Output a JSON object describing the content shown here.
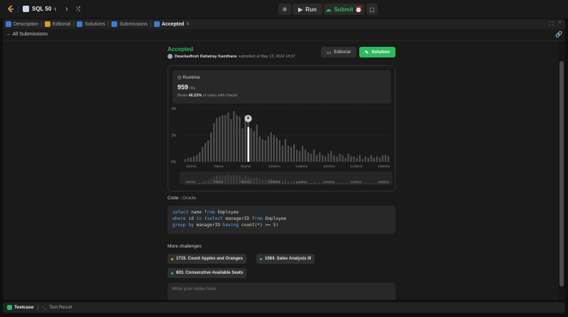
{
  "topbar": {
    "problem_list_title": "SQL 50",
    "run_label": "Run",
    "submit_label": "Submit"
  },
  "tabs": [
    {
      "label": "Description"
    },
    {
      "label": "Editorial"
    },
    {
      "label": "Solutions"
    },
    {
      "label": "Submissions"
    },
    {
      "label": "Accepted",
      "close": "×"
    }
  ],
  "subbar": {
    "back_label": "All Submissions"
  },
  "submission": {
    "status": "Accepted",
    "username": "Dwarkadhish Dattatray Kamthane",
    "submitted_text": "submitted at May 13, 2024 18:57",
    "editorial_label": "Editorial",
    "solution_label": "Solution"
  },
  "runtime": {
    "label": "Runtime",
    "value": "959",
    "unit": "ms",
    "beats_prefix": "Beats",
    "beats_value": "46.53%",
    "beats_suffix": "of users with Oracle"
  },
  "chart_data": {
    "type": "bar",
    "y_ticks": [
      "4%",
      "2%",
      "0%"
    ],
    "ylim": [
      0,
      4
    ],
    "x_tick_labels": [
      "634ms",
      "768ms",
      "901ms",
      "1035ms",
      "1168ms",
      "1302ms",
      "1435ms",
      "1569ms"
    ],
    "values": [
      0.2,
      0.3,
      0.3,
      0.4,
      0.5,
      0.7,
      1.1,
      1.4,
      1.6,
      2.2,
      2.9,
      3.3,
      3.4,
      3.5,
      3.5,
      3.7,
      3.2,
      3.8,
      3.5,
      3.4,
      2.5,
      3.5,
      3.0,
      2.5,
      2.3,
      2.8,
      1.9,
      1.7,
      1.6,
      1.9,
      2.2,
      2.0,
      1.8,
      1.6,
      1.2,
      1.7,
      1.2,
      1.1,
      1.3,
      0.9,
      0.8,
      1.2,
      0.9,
      0.7,
      0.6,
      0.9,
      0.5,
      0.7,
      0.5,
      0.4,
      0.6,
      0.8,
      0.5,
      0.4,
      0.6,
      0.5,
      0.3,
      0.6,
      0.4,
      0.4,
      0.3,
      0.5,
      0.2,
      0.4,
      0.3,
      0.5,
      0.3,
      0.4,
      0.3,
      0.5,
      0.5,
      0.4
    ],
    "highlight_index": 22,
    "highlight_value": 2.6,
    "grid": true,
    "colors": {
      "bar": "#505050",
      "highlight": "#ffffff",
      "grid": "#3a3a3a"
    }
  },
  "code": {
    "title": "Code",
    "lang": "Oracle",
    "lines": [
      [
        {
          "t": "select ",
          "k": "kw"
        },
        {
          "t": "name "
        },
        {
          "t": "from ",
          "k": "kw"
        },
        {
          "t": "Employee"
        }
      ],
      [
        {
          "t": "where ",
          "k": "kw"
        },
        {
          "t": "id "
        },
        {
          "t": "in ",
          "k": "kw"
        },
        {
          "t": "("
        },
        {
          "t": "select ",
          "k": "kw"
        },
        {
          "t": "managerID "
        },
        {
          "t": "from ",
          "k": "kw"
        },
        {
          "t": "Employee"
        }
      ],
      [
        {
          "t": "group by ",
          "k": "kw"
        },
        {
          "t": "managerID "
        },
        {
          "t": "having ",
          "k": "kw"
        },
        {
          "t": "count",
          "k": "fn"
        },
        {
          "t": "(*) >= 5)"
        }
      ]
    ]
  },
  "more_challenges": {
    "title": "More challenges",
    "items": [
      {
        "label": "1715. Count Apples and Oranges",
        "color": "#ffa116"
      },
      {
        "label": "1084. Sales Analysis III",
        "color": "#2db7b3"
      },
      {
        "label": "603. Consecutive Available Seats",
        "color": "#2db7b3"
      }
    ]
  },
  "notes": {
    "placeholder": "Write your notes here"
  },
  "bottom": {
    "testcase_label": "Testcase",
    "result_label": "Test Result"
  }
}
